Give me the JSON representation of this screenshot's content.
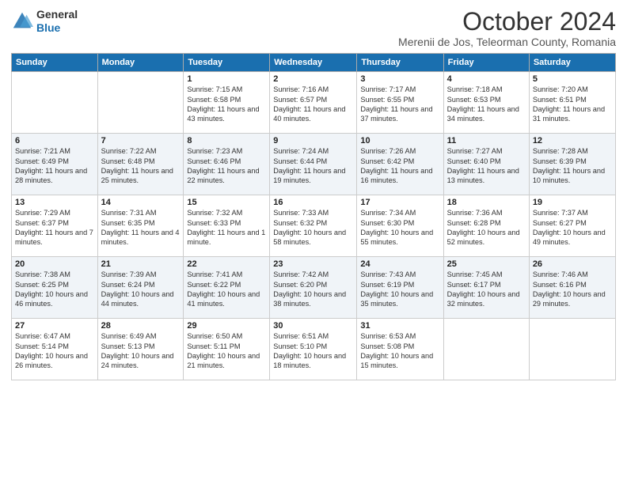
{
  "header": {
    "logo_general": "General",
    "logo_blue": "Blue",
    "month_title": "October 2024",
    "subtitle": "Merenii de Jos, Teleorman County, Romania"
  },
  "days_of_week": [
    "Sunday",
    "Monday",
    "Tuesday",
    "Wednesday",
    "Thursday",
    "Friday",
    "Saturday"
  ],
  "weeks": [
    [
      {
        "day": "",
        "info": ""
      },
      {
        "day": "",
        "info": ""
      },
      {
        "day": "1",
        "info": "Sunrise: 7:15 AM\nSunset: 6:58 PM\nDaylight: 11 hours and 43 minutes."
      },
      {
        "day": "2",
        "info": "Sunrise: 7:16 AM\nSunset: 6:57 PM\nDaylight: 11 hours and 40 minutes."
      },
      {
        "day": "3",
        "info": "Sunrise: 7:17 AM\nSunset: 6:55 PM\nDaylight: 11 hours and 37 minutes."
      },
      {
        "day": "4",
        "info": "Sunrise: 7:18 AM\nSunset: 6:53 PM\nDaylight: 11 hours and 34 minutes."
      },
      {
        "day": "5",
        "info": "Sunrise: 7:20 AM\nSunset: 6:51 PM\nDaylight: 11 hours and 31 minutes."
      }
    ],
    [
      {
        "day": "6",
        "info": "Sunrise: 7:21 AM\nSunset: 6:49 PM\nDaylight: 11 hours and 28 minutes."
      },
      {
        "day": "7",
        "info": "Sunrise: 7:22 AM\nSunset: 6:48 PM\nDaylight: 11 hours and 25 minutes."
      },
      {
        "day": "8",
        "info": "Sunrise: 7:23 AM\nSunset: 6:46 PM\nDaylight: 11 hours and 22 minutes."
      },
      {
        "day": "9",
        "info": "Sunrise: 7:24 AM\nSunset: 6:44 PM\nDaylight: 11 hours and 19 minutes."
      },
      {
        "day": "10",
        "info": "Sunrise: 7:26 AM\nSunset: 6:42 PM\nDaylight: 11 hours and 16 minutes."
      },
      {
        "day": "11",
        "info": "Sunrise: 7:27 AM\nSunset: 6:40 PM\nDaylight: 11 hours and 13 minutes."
      },
      {
        "day": "12",
        "info": "Sunrise: 7:28 AM\nSunset: 6:39 PM\nDaylight: 11 hours and 10 minutes."
      }
    ],
    [
      {
        "day": "13",
        "info": "Sunrise: 7:29 AM\nSunset: 6:37 PM\nDaylight: 11 hours and 7 minutes."
      },
      {
        "day": "14",
        "info": "Sunrise: 7:31 AM\nSunset: 6:35 PM\nDaylight: 11 hours and 4 minutes."
      },
      {
        "day": "15",
        "info": "Sunrise: 7:32 AM\nSunset: 6:33 PM\nDaylight: 11 hours and 1 minute."
      },
      {
        "day": "16",
        "info": "Sunrise: 7:33 AM\nSunset: 6:32 PM\nDaylight: 10 hours and 58 minutes."
      },
      {
        "day": "17",
        "info": "Sunrise: 7:34 AM\nSunset: 6:30 PM\nDaylight: 10 hours and 55 minutes."
      },
      {
        "day": "18",
        "info": "Sunrise: 7:36 AM\nSunset: 6:28 PM\nDaylight: 10 hours and 52 minutes."
      },
      {
        "day": "19",
        "info": "Sunrise: 7:37 AM\nSunset: 6:27 PM\nDaylight: 10 hours and 49 minutes."
      }
    ],
    [
      {
        "day": "20",
        "info": "Sunrise: 7:38 AM\nSunset: 6:25 PM\nDaylight: 10 hours and 46 minutes."
      },
      {
        "day": "21",
        "info": "Sunrise: 7:39 AM\nSunset: 6:24 PM\nDaylight: 10 hours and 44 minutes."
      },
      {
        "day": "22",
        "info": "Sunrise: 7:41 AM\nSunset: 6:22 PM\nDaylight: 10 hours and 41 minutes."
      },
      {
        "day": "23",
        "info": "Sunrise: 7:42 AM\nSunset: 6:20 PM\nDaylight: 10 hours and 38 minutes."
      },
      {
        "day": "24",
        "info": "Sunrise: 7:43 AM\nSunset: 6:19 PM\nDaylight: 10 hours and 35 minutes."
      },
      {
        "day": "25",
        "info": "Sunrise: 7:45 AM\nSunset: 6:17 PM\nDaylight: 10 hours and 32 minutes."
      },
      {
        "day": "26",
        "info": "Sunrise: 7:46 AM\nSunset: 6:16 PM\nDaylight: 10 hours and 29 minutes."
      }
    ],
    [
      {
        "day": "27",
        "info": "Sunrise: 6:47 AM\nSunset: 5:14 PM\nDaylight: 10 hours and 26 minutes."
      },
      {
        "day": "28",
        "info": "Sunrise: 6:49 AM\nSunset: 5:13 PM\nDaylight: 10 hours and 24 minutes."
      },
      {
        "day": "29",
        "info": "Sunrise: 6:50 AM\nSunset: 5:11 PM\nDaylight: 10 hours and 21 minutes."
      },
      {
        "day": "30",
        "info": "Sunrise: 6:51 AM\nSunset: 5:10 PM\nDaylight: 10 hours and 18 minutes."
      },
      {
        "day": "31",
        "info": "Sunrise: 6:53 AM\nSunset: 5:08 PM\nDaylight: 10 hours and 15 minutes."
      },
      {
        "day": "",
        "info": ""
      },
      {
        "day": "",
        "info": ""
      }
    ]
  ]
}
